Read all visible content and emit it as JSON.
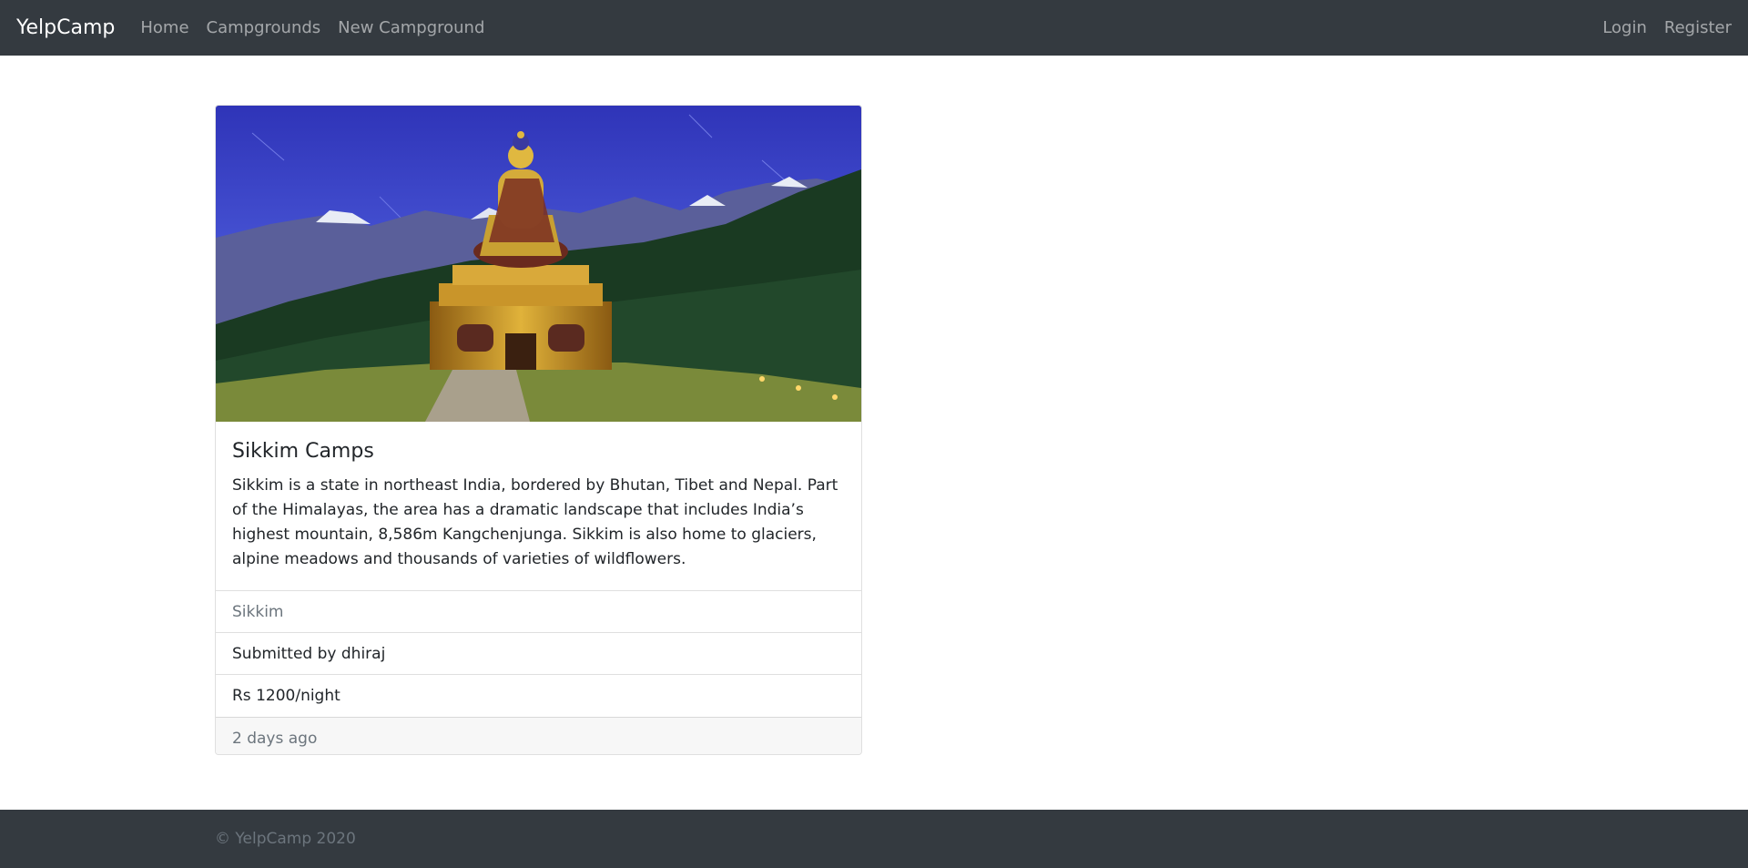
{
  "navbar": {
    "brand": "YelpCamp",
    "links": [
      "Home",
      "Campgrounds",
      "New Campground"
    ],
    "right_links": [
      "Login",
      "Register"
    ]
  },
  "campground": {
    "image_alt": "Buddha statue in Sikkim",
    "title": "Sikkim Camps",
    "description": "Sikkim is a state in northeast India, bordered by Bhutan, Tibet and Nepal. Part of the Himalayas, the area has a dramatic landscape that includes India’s highest mountain, 8,586m Kangchenjunga. Sikkim is also home to glaciers, alpine meadows and thousands of varieties of wildflowers.",
    "location": "Sikkim",
    "submitted_by": "Submitted by dhiraj",
    "price": "Rs 1200/night",
    "posted": "2 days ago"
  },
  "footer": {
    "copyright": "© YelpCamp 2020"
  },
  "colors": {
    "navbar_bg": "#343a40",
    "muted": "#6c757d"
  }
}
